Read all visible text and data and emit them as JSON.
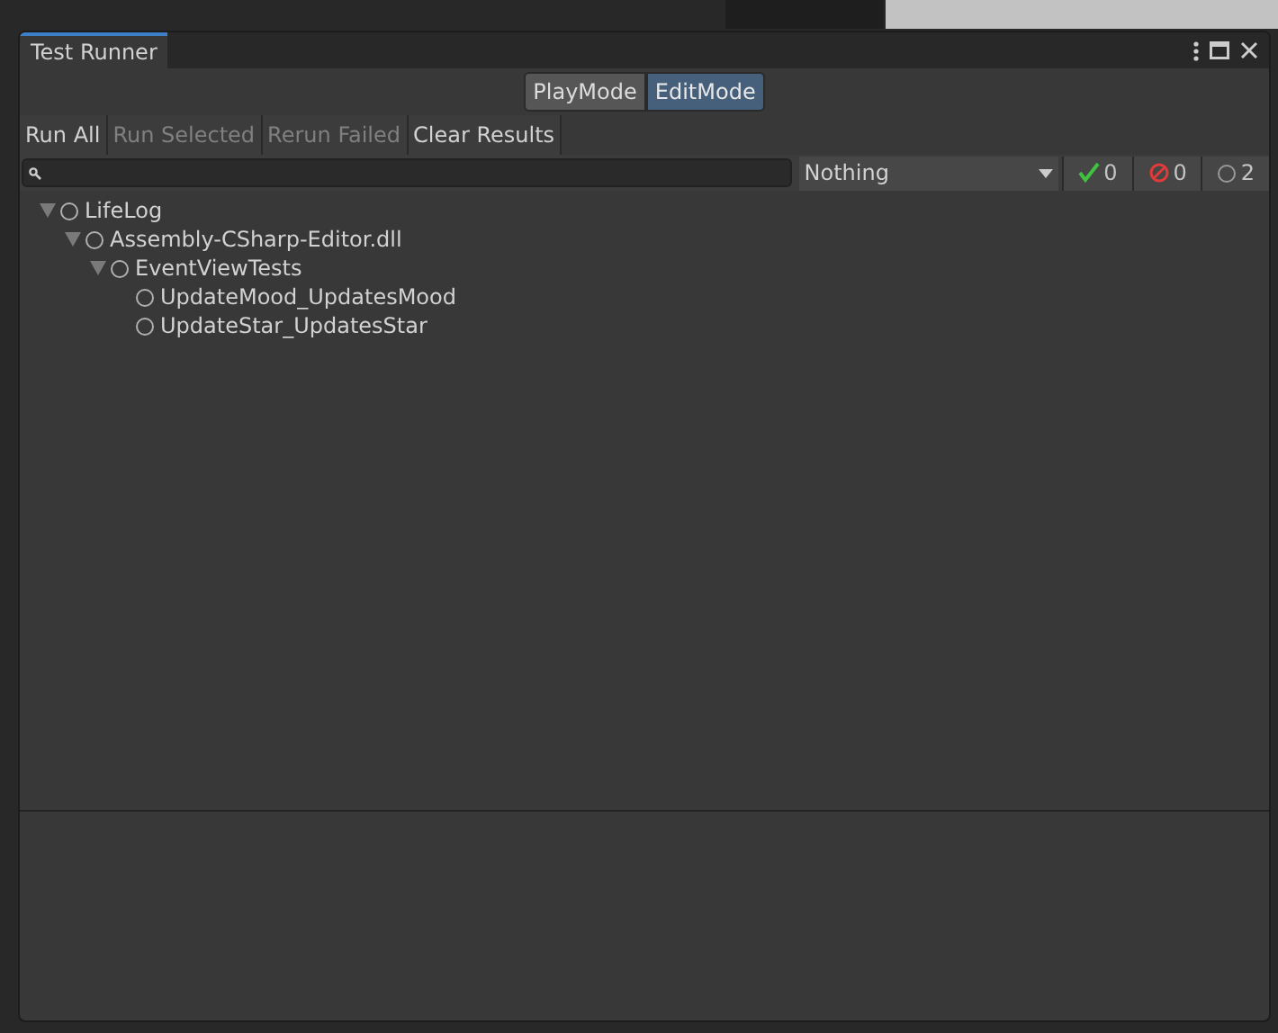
{
  "window": {
    "title": "Test Runner"
  },
  "mode_tabs": [
    {
      "label": "PlayMode",
      "selected": false
    },
    {
      "label": "EditMode",
      "selected": true
    }
  ],
  "toolbar": [
    {
      "label": "Run All",
      "disabled": false
    },
    {
      "label": "Run Selected",
      "disabled": true
    },
    {
      "label": "Rerun Failed",
      "disabled": true
    },
    {
      "label": "Clear Results",
      "disabled": false
    }
  ],
  "filter": {
    "value": "Nothing"
  },
  "counters": [
    {
      "kind": "passed",
      "count": "0"
    },
    {
      "kind": "failed",
      "count": "0"
    },
    {
      "kind": "notrun",
      "count": "2"
    }
  ],
  "tree": [
    {
      "label": "LifeLog",
      "expanded": true,
      "children": [
        {
          "label": "Assembly-CSharp-Editor.dll",
          "expanded": true,
          "children": [
            {
              "label": "EventViewTests",
              "expanded": true,
              "children": [
                {
                  "label": "UpdateMood_UpdatesMood"
                },
                {
                  "label": "UpdateStar_UpdatesStar"
                }
              ]
            }
          ]
        }
      ]
    }
  ]
}
